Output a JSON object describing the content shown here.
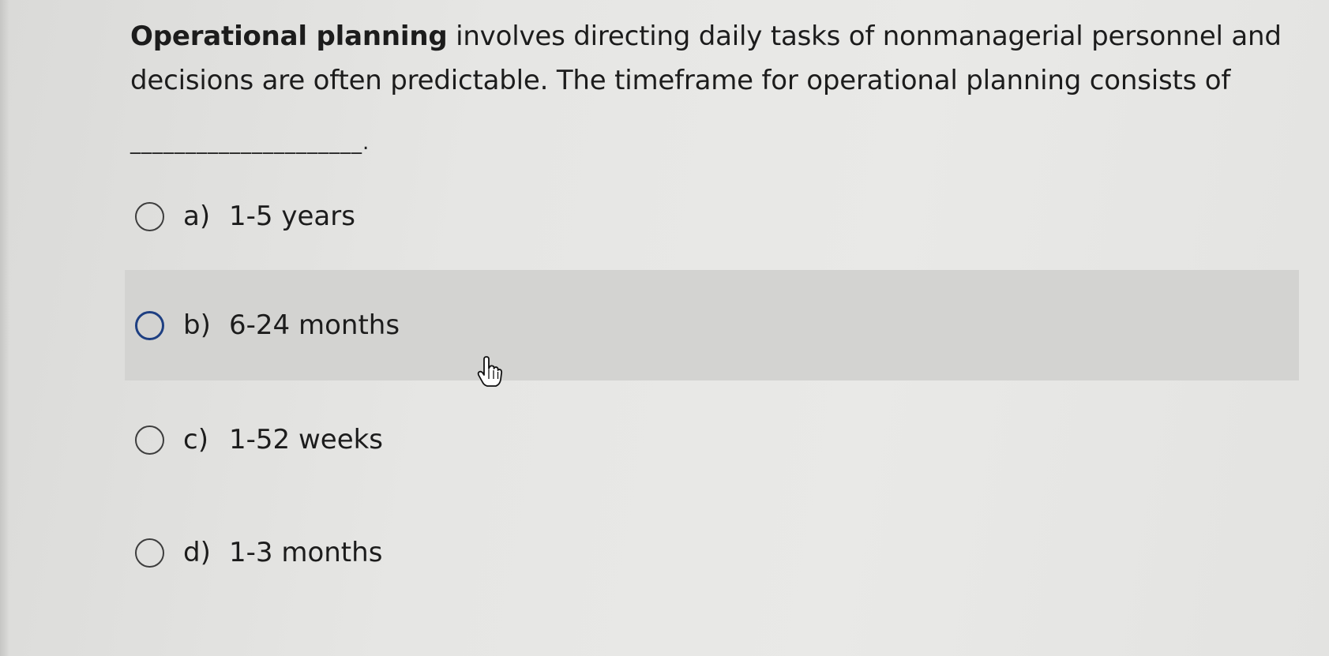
{
  "question": {
    "lead": "Operational planning",
    "body": " involves directing daily tasks of nonmanagerial personnel and decisions are often predictable. The timeframe for operational planning consists of",
    "blank": "_____________________."
  },
  "options": [
    {
      "letter": "a)",
      "text": "1-5 years",
      "selected": false,
      "hovered": false
    },
    {
      "letter": "b)",
      "text": "6-24 months",
      "selected": false,
      "hovered": true
    },
    {
      "letter": "c)",
      "text": "1-52 weeks",
      "selected": false,
      "hovered": false
    },
    {
      "letter": "d)",
      "text": "1-3 months",
      "selected": false,
      "hovered": false
    }
  ],
  "colors": {
    "hover_row": "#d3d3d1",
    "hover_radio": "#1e3f82",
    "radio": "#3d3d3d"
  },
  "cursor": {
    "icon": "hand-pointer-icon"
  }
}
